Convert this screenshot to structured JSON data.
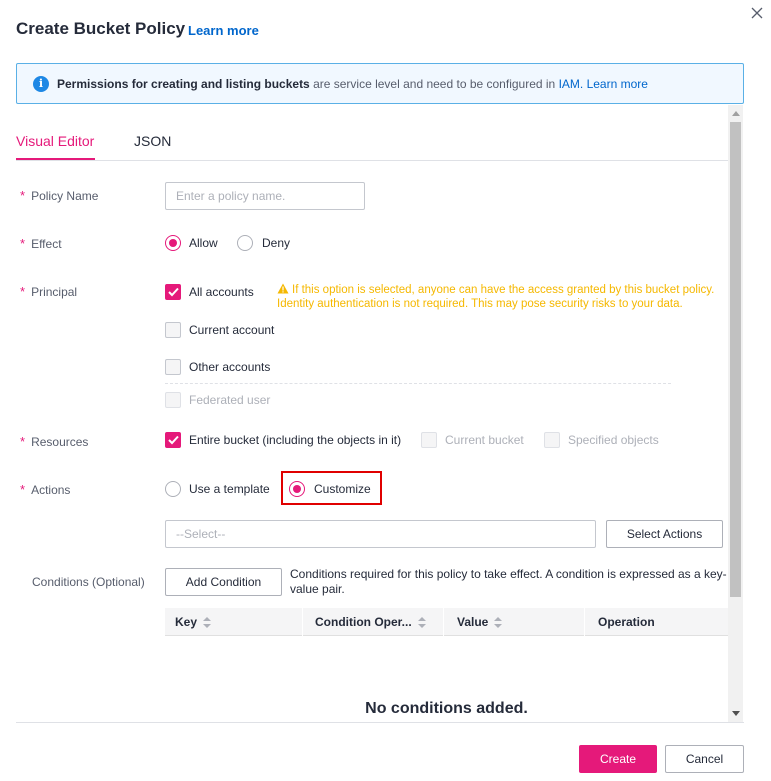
{
  "dialog": {
    "title": "Create Bucket Policy",
    "title_link": "Learn more"
  },
  "info": {
    "bold": "Permissions for creating and listing buckets",
    "middle": " are service level and need to be configured in ",
    "iam": "IAM.",
    "link": "Learn more"
  },
  "tabs": [
    {
      "label": "Visual Editor",
      "active": true
    },
    {
      "label": "JSON",
      "active": false
    }
  ],
  "form": {
    "required_mark": "*",
    "policy_name": {
      "label": "Policy Name",
      "placeholder": "Enter a policy name."
    },
    "effect": {
      "label": "Effect",
      "options": [
        "Allow",
        "Deny"
      ],
      "selected": "Allow"
    },
    "principal": {
      "label": "Principal",
      "options": [
        "All accounts",
        "Current account",
        "Other accounts",
        "Federated user"
      ],
      "checked": "All accounts",
      "warning": "If this option is selected, anyone can have the access granted by this bucket policy. Identity authentication is not required. This may pose security risks to your data."
    },
    "resources": {
      "label": "Resources",
      "options": [
        "Entire bucket (including the objects in it)",
        "Current bucket",
        "Specified objects"
      ],
      "checked": "Entire bucket (including the objects in it)"
    },
    "actions": {
      "label": "Actions",
      "options": [
        "Use a template",
        "Customize"
      ],
      "selected": "Customize",
      "select_placeholder": "--Select--",
      "select_button": "Select Actions"
    },
    "conditions": {
      "label": "Conditions (Optional)",
      "add_button": "Add Condition",
      "description": "Conditions required for this policy to take effect. A condition is expressed as a key-value pair.",
      "columns": [
        "Key",
        "Condition Oper...",
        "Value",
        "Operation"
      ],
      "empty": "No conditions added."
    }
  },
  "footer": {
    "create": "Create",
    "cancel": "Cancel"
  },
  "colors": {
    "accent": "#e5197a",
    "link": "#0066cc",
    "warning": "#f5b800",
    "highlight": "#e00000"
  }
}
